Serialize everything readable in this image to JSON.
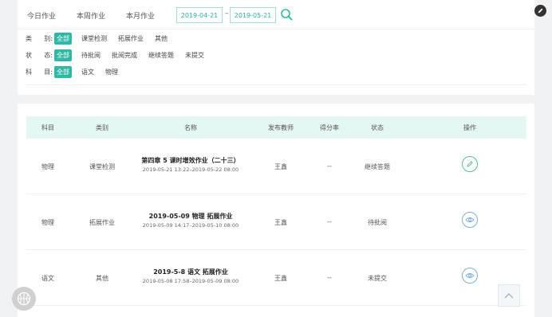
{
  "range_tabs": [
    "今日作业",
    "本周作业",
    "本月作业"
  ],
  "date_range": {
    "start": "2019-04-21",
    "separator": "–",
    "end": "2019-05-21"
  },
  "filters": {
    "category": {
      "label_a": "类",
      "label_b": "别:",
      "options": [
        "全部",
        "课堂检测",
        "拓展作业",
        "其他"
      ],
      "active": 0
    },
    "status": {
      "label_a": "状",
      "label_b": "态:",
      "options": [
        "全部",
        "待批阅",
        "批阅完成",
        "继续答题",
        "未提交"
      ],
      "active": 0
    },
    "subject": {
      "label_a": "科",
      "label_b": "目:",
      "options": [
        "全部",
        "语文",
        "物理"
      ],
      "active": 0
    }
  },
  "table": {
    "headers": [
      "科目",
      "类别",
      "名称",
      "发布教师",
      "得分率",
      "状态",
      "操作"
    ],
    "rows": [
      {
        "subject": "物理",
        "category": "课堂检测",
        "title": "第四章 5 课时增效作业（二十三）",
        "time": "2019-05-21 13:22–2019-05-22 08:00",
        "teacher": "王鑫",
        "score": "--",
        "status": "继续答题",
        "action": "edit"
      },
      {
        "subject": "物理",
        "category": "拓展作业",
        "title": "2019-05-09 物理 拓展作业",
        "time": "2019-05-09 14:17–2019-05-10 08:00",
        "teacher": "王鑫",
        "score": "--",
        "status": "待批阅",
        "action": "view"
      },
      {
        "subject": "语文",
        "category": "其他",
        "title": "2019-5-8 语文 拓展作业",
        "time": "2019-05-08 17:58–2019-05-09 08:00",
        "teacher": "王鑫",
        "score": "--",
        "status": "未提交",
        "action": "view"
      }
    ]
  },
  "colors": {
    "accent": "#2fb9a4",
    "header_bg": "#e5f7f2",
    "edit": "#52c28a",
    "view": "#7fb0d8"
  },
  "icons": {
    "search": "search-icon",
    "edit": "pencil-icon",
    "view": "eye-icon",
    "top": "chevron-up-icon",
    "fab": "basketball-icon",
    "corner": "edit-icon"
  }
}
